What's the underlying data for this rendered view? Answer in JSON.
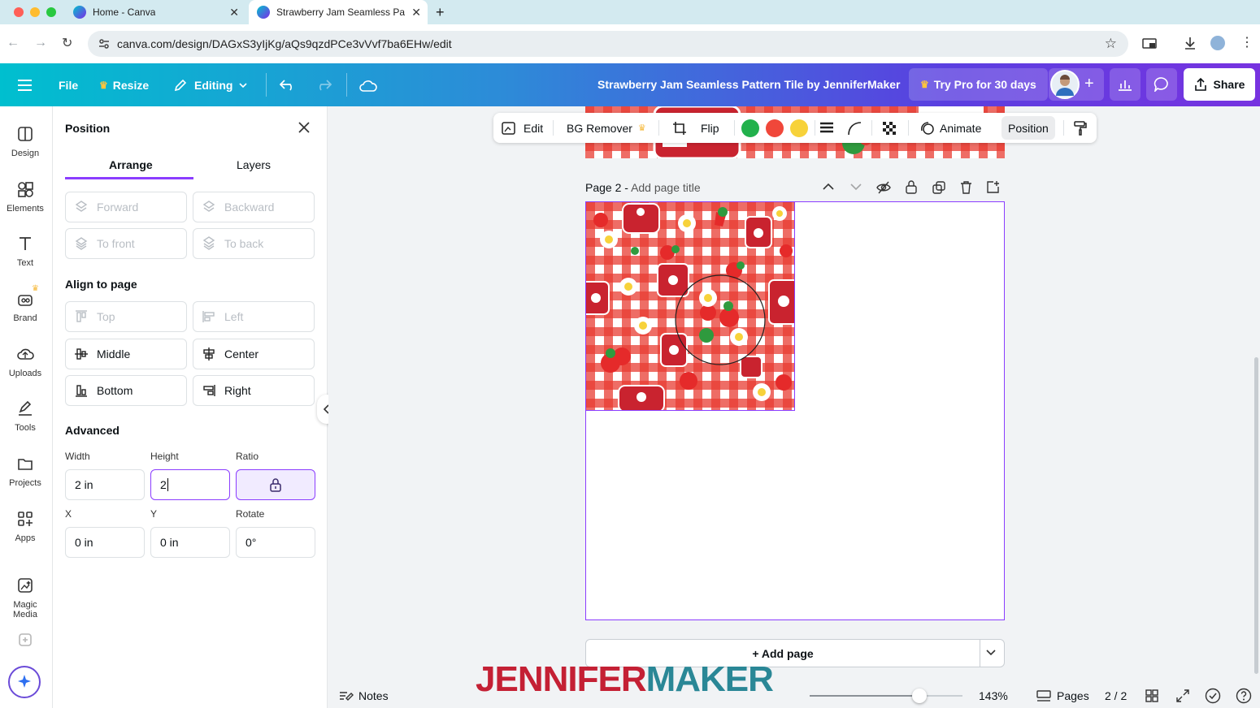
{
  "browser": {
    "tabs": [
      {
        "title": "Home - Canva"
      },
      {
        "title": "Strawberry Jam Seamless Pa"
      }
    ],
    "new_tab": "+",
    "url": "canva.com/design/DAGxS3yIjKg/aQs9qzdPCe3vVvf7ba6EHw/edit"
  },
  "header": {
    "file": "File",
    "resize": "Resize",
    "editing": "Editing",
    "title": "Strawberry Jam Seamless Pattern Tile by JenniferMaker",
    "try_pro": "Try Pro for 30 days",
    "share": "Share"
  },
  "sidebar": {
    "items": [
      {
        "label": "Design"
      },
      {
        "label": "Elements"
      },
      {
        "label": "Text"
      },
      {
        "label": "Brand"
      },
      {
        "label": "Uploads"
      },
      {
        "label": "Tools"
      },
      {
        "label": "Projects"
      },
      {
        "label": "Apps"
      },
      {
        "label": "Magic Media"
      }
    ]
  },
  "panel": {
    "title": "Position",
    "tabs": {
      "arrange": "Arrange",
      "layers": "Layers"
    },
    "layer_buttons": {
      "forward": "Forward",
      "backward": "Backward",
      "to_front": "To front",
      "to_back": "To back"
    },
    "align_heading": "Align to page",
    "align_buttons": {
      "top": "Top",
      "left": "Left",
      "middle": "Middle",
      "center": "Center",
      "bottom": "Bottom",
      "right": "Right"
    },
    "advanced_heading": "Advanced",
    "labels": {
      "width": "Width",
      "height": "Height",
      "ratio": "Ratio",
      "x": "X",
      "y": "Y",
      "rotate": "Rotate"
    },
    "values": {
      "width": "2 in",
      "height": "2",
      "x": "0 in",
      "y": "0 in",
      "rotate": "0°"
    }
  },
  "context_toolbar": {
    "edit": "Edit",
    "bg_remover": "BG Remover",
    "flip": "Flip",
    "colors": [
      "#22b14c",
      "#f0473a",
      "#f7d23a"
    ],
    "animate": "Animate",
    "position": "Position"
  },
  "canvas": {
    "page_label": "Page 2 -",
    "page_title_placeholder": "Add page title",
    "add_page": "+ Add page"
  },
  "footer": {
    "notes": "Notes",
    "zoom": "143%",
    "zoom_level": 0.72,
    "pages": "Pages",
    "page_count": "2 / 2"
  },
  "watermark": {
    "part1": "JENNIFER",
    "part2": "MAKER"
  },
  "colors": {
    "accent": "#8b3dff",
    "brand_red": "#c42034",
    "brand_teal": "#2a8796"
  }
}
